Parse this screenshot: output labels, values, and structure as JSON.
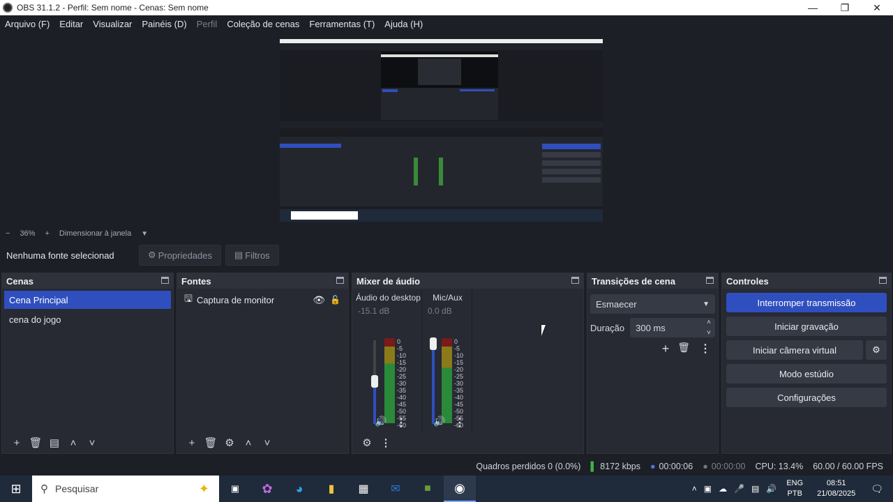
{
  "window": {
    "title": "OBS 31.1.2 - Perfil: Sem nome - Cenas: Sem nome"
  },
  "menu": [
    {
      "label": "Arquivo (F)",
      "disabled": false
    },
    {
      "label": "Editar",
      "disabled": false
    },
    {
      "label": "Visualizar",
      "disabled": false
    },
    {
      "label": "Painéis (D)",
      "disabled": false
    },
    {
      "label": "Perfil",
      "disabled": true
    },
    {
      "label": "Coleção de cenas",
      "disabled": false
    },
    {
      "label": "Ferramentas (T)",
      "disabled": false
    },
    {
      "label": "Ajuda (H)",
      "disabled": false
    }
  ],
  "zoom": {
    "minus": "−",
    "value": "36%",
    "plus": "+",
    "fit_label": "Dimensionar à janela"
  },
  "source_toolbar": {
    "no_source": "Nenhuma fonte selecionad",
    "properties": "Propriedades",
    "filters": "Filtros"
  },
  "scenes": {
    "title": "Cenas",
    "items": [
      "Cena Principal",
      "cena do jogo"
    ],
    "selected": 0
  },
  "sources": {
    "title": "Fontes",
    "items": [
      {
        "name": "Captura de monitor",
        "visible": true,
        "locked": false
      }
    ]
  },
  "mixer": {
    "title": "Mixer de áudio",
    "channels": [
      {
        "name": "Áudio do desktop",
        "db": "-15.1 dB",
        "level": 0.55
      },
      {
        "name": "Mic/Aux",
        "db": "0.0 dB",
        "level": 1.0
      }
    ],
    "scale": [
      "0",
      "-5",
      "-10",
      "-15",
      "-20",
      "-25",
      "-30",
      "-35",
      "-40",
      "-45",
      "-50",
      "-55",
      "-60"
    ]
  },
  "transitions": {
    "title": "Transições de cena",
    "selected": "Esmaecer",
    "duration_label": "Duração",
    "duration_value": "300 ms"
  },
  "controls": {
    "title": "Controles",
    "stop_stream": "Interromper transmissão",
    "start_recording": "Iniciar gravação",
    "virtual_cam": "Iniciar câmera virtual",
    "studio_mode": "Modo estúdio",
    "settings": "Configurações"
  },
  "status": {
    "dropped": "Quadros perdidos 0 (0.0%)",
    "bitrate": "8172 kbps",
    "stream_time": "00:00:06",
    "rec_time": "00:00:00",
    "cpu": "CPU: 13.4%",
    "fps": "60.00 / 60.00 FPS"
  },
  "taskbar": {
    "search_placeholder": "Pesquisar",
    "lang1": "ENG",
    "lang2": "PTB",
    "time": "08:51",
    "date": "21/08/2025"
  },
  "colors": {
    "accent": "#2f4fbf",
    "bg": "#1d1f26",
    "panel": "#272a33"
  }
}
